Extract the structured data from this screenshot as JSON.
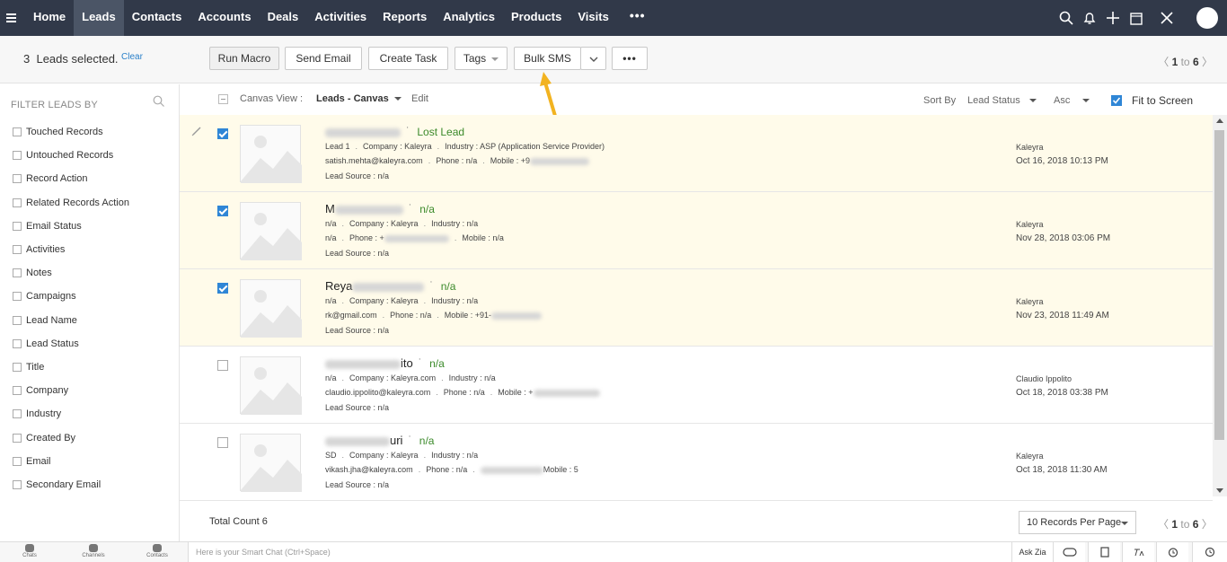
{
  "nav": {
    "tabs": [
      "Home",
      "Leads",
      "Contacts",
      "Accounts",
      "Deals",
      "Activities",
      "Reports",
      "Analytics",
      "Products",
      "Visits"
    ],
    "active_tab": "Leads",
    "more": "•••",
    "icons": [
      "search-icon",
      "bell-icon",
      "plus-icon",
      "calendar-icon",
      "tools-icon",
      "avatar"
    ]
  },
  "toolbar": {
    "selected_count": "3",
    "selected_text": "Leads selected.",
    "clear": "Clear",
    "run_macro": "Run Macro",
    "send_email": "Send Email",
    "create_task": "Create Task",
    "tags": "Tags",
    "bulk_sms": "Bulk SMS",
    "more": "•••",
    "pager_from": "1",
    "pager_to_word": "to",
    "pager_to": "6"
  },
  "sidebar": {
    "title": "FILTER LEADS BY",
    "items": [
      "Touched Records",
      "Untouched Records",
      "Record Action",
      "Related Records Action",
      "Email Status",
      "Activities",
      "Notes",
      "Campaigns",
      "Lead Name",
      "Lead Status",
      "Title",
      "Company",
      "Industry",
      "Created By",
      "Email",
      "Secondary Email"
    ]
  },
  "canvas": {
    "view_label": "Canvas View :",
    "view_value": "Leads - Canvas",
    "edit": "Edit",
    "sort_label": "Sort By",
    "sort_field": "Lead Status",
    "sort_dir": "Asc",
    "fit_to_screen": "Fit to Screen"
  },
  "records": [
    {
      "name_visible": "",
      "name_suffix": "",
      "status": "Lost Lead",
      "selected": true,
      "line1": [
        "Lead 1",
        "Company : Kaleyra",
        "Industry : ASP (Application Service Provider)"
      ],
      "line2": [
        "satish.mehta@kaleyra.com",
        "Phone : n/a",
        "Mobile : +9"
      ],
      "line3": "Lead Source : n/a",
      "owner": "Kaleyra",
      "date": "Oct 16, 2018 10:13 PM"
    },
    {
      "name_visible": "M",
      "name_suffix": "",
      "status": "n/a",
      "selected": true,
      "line1": [
        "n/a",
        "Company : Kaleyra",
        "Industry : n/a"
      ],
      "line2": [
        "n/a",
        "Phone : +",
        "Mobile : n/a"
      ],
      "line3": "Lead Source : n/a",
      "owner": "Kaleyra",
      "date": "Nov 28, 2018 03:06 PM"
    },
    {
      "name_visible": "Reya",
      "name_suffix": "",
      "status": "n/a",
      "selected": true,
      "line1": [
        "n/a",
        "Company : Kaleyra",
        "Industry : n/a"
      ],
      "line2": [
        "rk@gmail.com",
        "Phone : n/a",
        "Mobile : +91-"
      ],
      "line3": "Lead Source : n/a",
      "owner": "Kaleyra",
      "date": "Nov 23, 2018 11:49 AM"
    },
    {
      "name_visible": "",
      "name_suffix": "ito",
      "status": "n/a",
      "selected": false,
      "line1": [
        "n/a",
        "Company : Kaleyra.com",
        "Industry : n/a"
      ],
      "line2": [
        "claudio.ippolito@kaleyra.com",
        "Phone : n/a",
        "Mobile : +"
      ],
      "line3": "Lead Source : n/a",
      "owner": "Claudio Ippolito",
      "date": "Oct 18, 2018 03:38 PM"
    },
    {
      "name_visible": "",
      "name_suffix": "uri",
      "status": "n/a",
      "selected": false,
      "line1": [
        "SD",
        "Company : Kaleyra",
        "Industry : n/a"
      ],
      "line2": [
        "vikash.jha@kaleyra.com",
        "Phone : n/a",
        "Mobile : 5"
      ],
      "line3": "Lead Source : n/a",
      "owner": "Kaleyra",
      "date": "Oct 18, 2018 11:30 AM"
    }
  ],
  "footer": {
    "total": "Total Count 6",
    "records_per_page": "10 Records Per Page",
    "pager_from": "1",
    "pager_to_word": "to",
    "pager_to": "6"
  },
  "bottombar": {
    "chats": "Chats",
    "channels": "Channels",
    "contacts": "Contacts",
    "smart_chat_placeholder": "Here is your Smart Chat (Ctrl+Space)",
    "ask_zia": "Ask Zia"
  },
  "colors": {
    "nav_bg": "#313949",
    "active_tab": "#4b5566",
    "selected_row": "#fffbea",
    "status_green": "#3b8a2a",
    "accent_blue": "#2f86d6",
    "arrow_yellow": "#f2b320"
  }
}
